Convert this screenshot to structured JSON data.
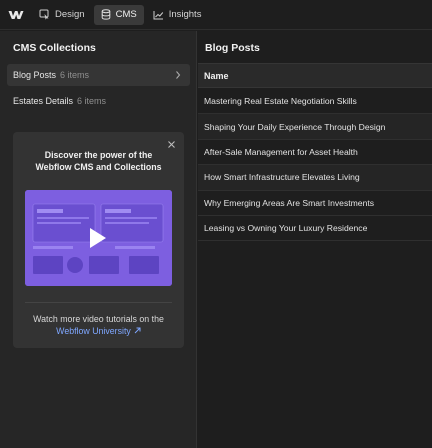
{
  "topbar": {
    "tabs": [
      {
        "label": "Design",
        "icon": "cursor-icon"
      },
      {
        "label": "CMS",
        "icon": "database-icon",
        "active": true
      },
      {
        "label": "Insights",
        "icon": "chart-icon"
      }
    ]
  },
  "left_panel": {
    "title": "CMS Collections",
    "collections": [
      {
        "name": "Blog Posts",
        "count": "6 items",
        "selected": true
      },
      {
        "name": "Estates Details",
        "count": "6 items",
        "selected": false
      }
    ],
    "promo": {
      "heading_line1": "Discover the power of the",
      "heading_line2": "Webflow CMS and Collections",
      "footer_text": "Watch more video tutorials on the",
      "link_text": "Webflow University"
    }
  },
  "right_panel": {
    "title": "Blog Posts",
    "column_header": "Name",
    "rows": [
      "Mastering Real Estate Negotiation Skills",
      "Shaping Your Daily Experience Through Design",
      "After-Sale Management for Asset Health",
      "How Smart Infrastructure Elevates Living",
      "Why Emerging Areas Are Smart Investments",
      "Leasing vs Owning Your Luxury Residence"
    ]
  },
  "colors": {
    "accent_link": "#7fa7ff",
    "video_bg": "#7d5fe0",
    "panel_bg": "#262626",
    "app_bg": "#1e1e1e"
  }
}
